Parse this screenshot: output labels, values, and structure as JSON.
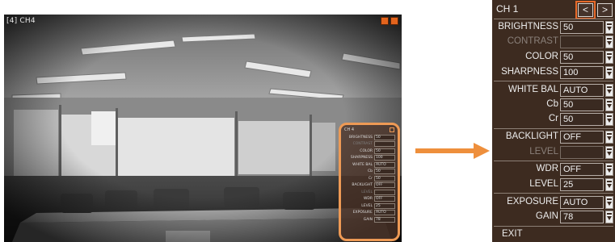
{
  "camera": {
    "channel_label": "[4] CH4",
    "icons": [
      "record-icon",
      "camera-status-icon"
    ]
  },
  "mini_menu": {
    "title": "CH 4",
    "rows": [
      {
        "label": "BRIGHTNESS",
        "value": "50",
        "disabled": false
      },
      {
        "label": "CONTRAST",
        "value": "",
        "disabled": true
      },
      {
        "label": "COLOR",
        "value": "50",
        "disabled": false
      },
      {
        "label": "SHARPNESS",
        "value": "100",
        "disabled": false
      },
      {
        "label": "WHITE BAL",
        "value": "AUTO",
        "disabled": false
      },
      {
        "label": "Cb",
        "value": "50",
        "disabled": false
      },
      {
        "label": "Cr",
        "value": "50",
        "disabled": false
      },
      {
        "label": "BACKLIGHT",
        "value": "OFF",
        "disabled": false
      },
      {
        "label": "LEVEL",
        "value": "",
        "disabled": true
      },
      {
        "label": "WDR",
        "value": "OFF",
        "disabled": false
      },
      {
        "label": "LEVEL",
        "value": "25",
        "disabled": false
      },
      {
        "label": "EXPOSURE",
        "value": "AUTO",
        "disabled": false
      },
      {
        "label": "GAIN",
        "value": "78",
        "disabled": false
      }
    ]
  },
  "osd": {
    "title": "CH 1",
    "prev_label": "<",
    "next_label": ">",
    "rows": {
      "brightness": {
        "label": "BRIGHTNESS",
        "value": "50"
      },
      "contrast": {
        "label": "CONTRAST",
        "value": ""
      },
      "color": {
        "label": "COLOR",
        "value": "50"
      },
      "sharpness": {
        "label": "SHARPNESS",
        "value": "100"
      },
      "white_bal": {
        "label": "WHITE BAL",
        "value": "AUTO"
      },
      "cb": {
        "label": "Cb",
        "value": "50"
      },
      "cr": {
        "label": "Cr",
        "value": "50"
      },
      "backlight": {
        "label": "BACKLIGHT",
        "value": "OFF"
      },
      "backlight_level": {
        "label": "LEVEL",
        "value": ""
      },
      "wdr": {
        "label": "WDR",
        "value": "OFF"
      },
      "wdr_level": {
        "label": "LEVEL",
        "value": "25"
      },
      "exposure": {
        "label": "EXPOSURE",
        "value": "AUTO"
      },
      "gain": {
        "label": "GAIN",
        "value": "78"
      }
    },
    "exit_label": "EXIT"
  },
  "colors": {
    "accent": "#e86a2a",
    "arrow": "#ee8f3c",
    "panel_bg": "#3d2b20"
  }
}
